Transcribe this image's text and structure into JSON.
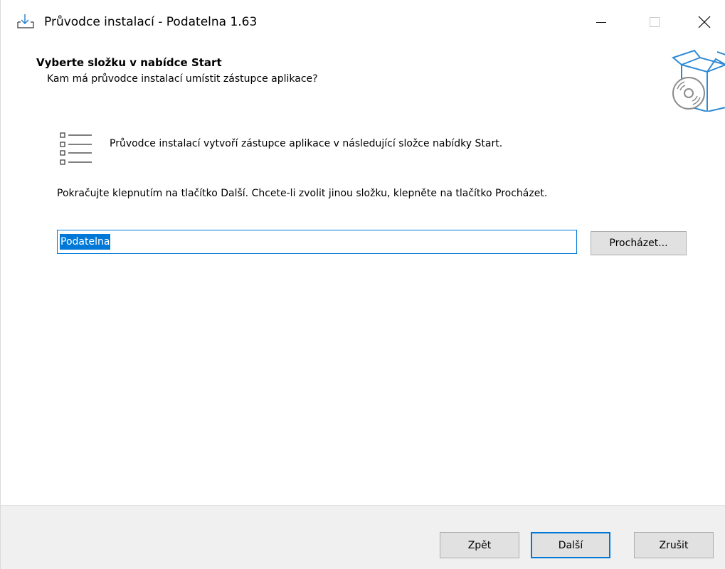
{
  "window": {
    "title": "Průvodce instalací - Podatelna 1.63"
  },
  "header": {
    "title": "Vyberte složku v nabídce Start",
    "subtitle": "Kam má průvodce instalací umístit zástupce aplikace?"
  },
  "content": {
    "info_text": "Průvodce instalací vytvoří zástupce aplikace v následující složce nabídky Start.",
    "instruction": "Pokračujte klepnutím na tlačítko Další. Chcete-li zvolit jinou složku, klepněte na tlačítko Procházet.",
    "folder_value": "Podatelna",
    "browse_label": "Procházet..."
  },
  "footer": {
    "back_label": "Zpět",
    "next_label": "Další",
    "cancel_label": "Zrušit"
  },
  "colors": {
    "accent": "#0078d7",
    "button_face": "#e1e1e1",
    "footer_bg": "#f0f0f0"
  },
  "icons": {
    "app": "download-icon",
    "minimize": "minimize-icon",
    "maximize": "maximize-icon",
    "close": "close-icon",
    "header": "software-box-cd-icon",
    "menu": "start-menu-list-icon"
  }
}
